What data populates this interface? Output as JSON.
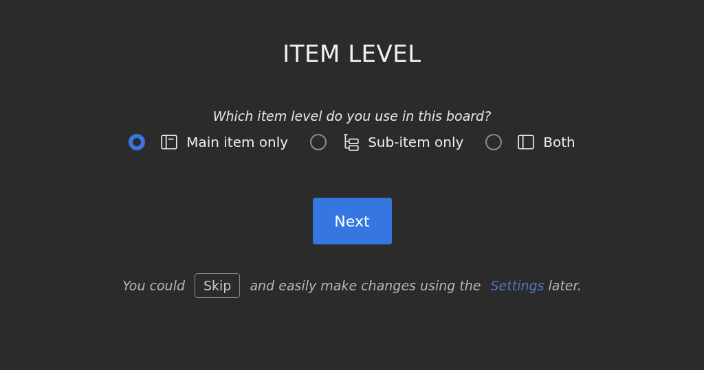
{
  "title": "ITEM LEVEL",
  "question": "Which item level do you use in this board?",
  "options": [
    {
      "label": "Main item only",
      "kind": "main",
      "selected": true
    },
    {
      "label": "Sub-item only",
      "kind": "sub",
      "selected": false
    },
    {
      "label": "Both",
      "kind": "both",
      "selected": false
    }
  ],
  "next_button": "Next",
  "footer": {
    "before": "You could",
    "skip_button": "Skip",
    "middle": "and easily make changes using the",
    "link": "Settings",
    "after": "later."
  }
}
